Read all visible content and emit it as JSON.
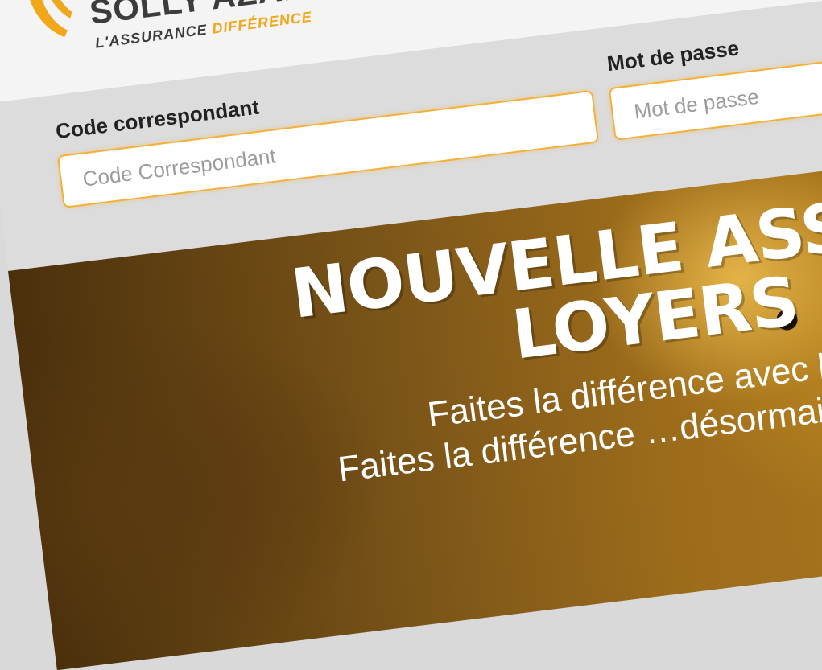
{
  "brand": {
    "name": "SOLLY AZAR",
    "tagline_part1": "L'ASSURANCE",
    "tagline_part2": "DIFFÉRENCE",
    "accent_color": "#f0a81a",
    "logo_icon": "solly-azar-logo-icon"
  },
  "login": {
    "code_label": "Code correspondant",
    "code_placeholder": "Code Correspondant",
    "password_label": "Mot de passe",
    "password_placeholder": "Mot de passe"
  },
  "hero": {
    "title_line1": "NOUVELLE ASSUR",
    "title_line2": "LOYERS I",
    "subtitle_line1": "Faites la différence avec l'offre GLI à la ca",
    "subtitle_line2": "Faites la différence …désormais la possibi"
  }
}
